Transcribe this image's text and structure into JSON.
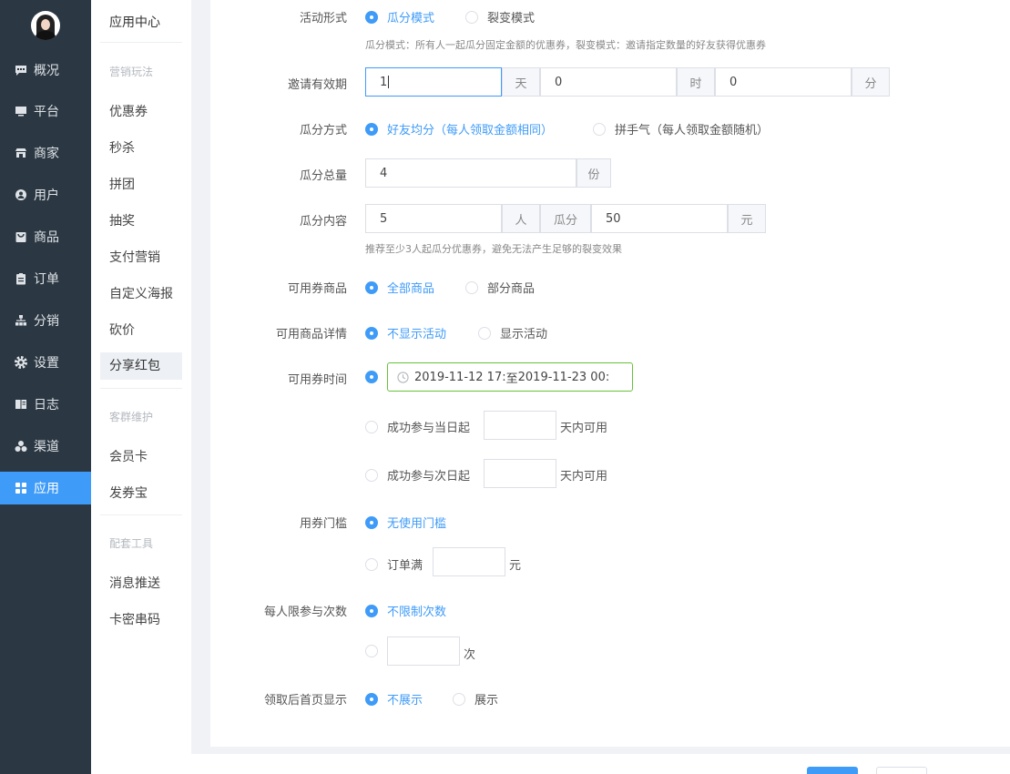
{
  "nav": {
    "items": [
      {
        "label": "概况",
        "icon": "chat-icon"
      },
      {
        "label": "平台",
        "icon": "monitor-icon"
      },
      {
        "label": "商家",
        "icon": "store-icon"
      },
      {
        "label": "用户",
        "icon": "user-icon"
      },
      {
        "label": "商品",
        "icon": "bag-icon"
      },
      {
        "label": "订单",
        "icon": "clipboard-icon"
      },
      {
        "label": "分销",
        "icon": "hierarchy-icon"
      },
      {
        "label": "设置",
        "icon": "gear-icon"
      },
      {
        "label": "日志",
        "icon": "book-icon"
      },
      {
        "label": "渠道",
        "icon": "cluster-icon"
      },
      {
        "label": "应用",
        "icon": "grid-icon"
      }
    ],
    "active": "应用"
  },
  "subnav": {
    "title": "应用中心",
    "group1": "营销玩法",
    "group1_items": [
      "优惠券",
      "秒杀",
      "拼团",
      "抽奖",
      "支付营销",
      "自定义海报",
      "砍价",
      "分享红包"
    ],
    "group2": "客群维护",
    "group2_items": [
      "会员卡",
      "发券宝"
    ],
    "group3": "配套工具",
    "group3_items": [
      "消息推送",
      "卡密串码"
    ],
    "active": "分享红包"
  },
  "form": {
    "mode": {
      "label": "活动形式",
      "opt1": "瓜分模式",
      "opt2": "裂变模式",
      "hint": "瓜分模式：所有人一起瓜分固定金额的优惠券，裂变模式：邀请指定数量的好友获得优惠券"
    },
    "validity": {
      "label": "邀请有效期",
      "days": "1",
      "days_unit": "天",
      "hours": "0",
      "hours_unit": "时",
      "minutes": "0",
      "minutes_unit": "分"
    },
    "split_method": {
      "label": "瓜分方式",
      "opt1": "好友均分（每人领取金额相同）",
      "opt2": "拼手气（每人领取金额随机）"
    },
    "total": {
      "label": "瓜分总量",
      "value": "4",
      "unit": "份"
    },
    "content": {
      "label": "瓜分内容",
      "people": "5",
      "people_unit": "人",
      "mid": "瓜分",
      "amount": "50",
      "amount_unit": "元",
      "hint": "推荐至少3人起瓜分优惠券，避免无法产生足够的裂变效果"
    },
    "goods": {
      "label": "可用券商品",
      "opt1": "全部商品",
      "opt2": "部分商品"
    },
    "goods_detail": {
      "label": "可用商品详情",
      "opt1": "不显示活动",
      "opt2": "显示活动"
    },
    "coupon_time": {
      "label": "可用券时间",
      "start": "2019-11-12 17:",
      "sep": "至",
      "end": "2019-11-23 00:",
      "opt2_prefix": "成功参与当日起",
      "opt2_suffix": "天内可用",
      "opt3_prefix": "成功参与次日起",
      "opt3_suffix": "天内可用"
    },
    "threshold": {
      "label": "用券门槛",
      "opt1": "无使用门槛",
      "opt2_prefix": "订单满",
      "opt2_suffix": "元"
    },
    "limit": {
      "label": "每人限参与次数",
      "opt1": "不限制次数",
      "opt2_suffix": "次"
    },
    "home_display": {
      "label": "领取后首页显示",
      "opt1": "不展示",
      "opt2": "展示"
    }
  },
  "colors": {
    "primary": "#3f9bf8",
    "nav_bg": "#2b3742",
    "date_border": "#67c23a"
  }
}
